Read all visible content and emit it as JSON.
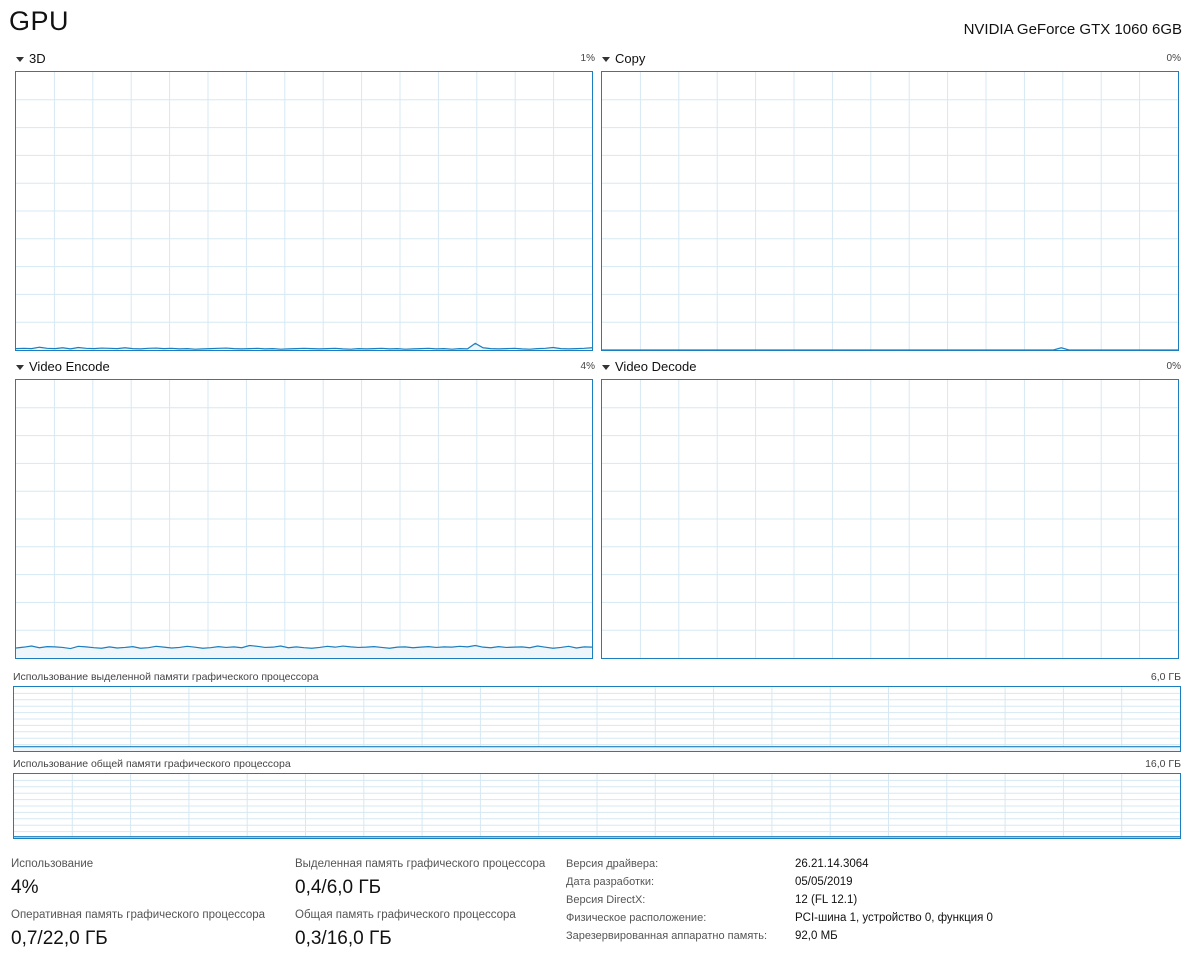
{
  "header": {
    "title": "GPU",
    "gpu_name": "NVIDIA GeForce GTX 1060 6GB"
  },
  "engines": [
    {
      "label": "3D",
      "percent": "1%",
      "samples": [
        0.5,
        0.6,
        0.5,
        1,
        0.6,
        0.5,
        0.8,
        0.4,
        0.9,
        0.6,
        0.5,
        0.7,
        0.6,
        0.5,
        0.8,
        0.5,
        0.4,
        0.6,
        0.7,
        0.5,
        0.6,
        0.4,
        0.5,
        0.3,
        0.4,
        0.5,
        0.6,
        0.7,
        0.5,
        0.4,
        0.5,
        0.6,
        0.4,
        0.5,
        0.3,
        0.4,
        0.5,
        0.6,
        0.5,
        0.4,
        0.5,
        0.6,
        0.4,
        0.3,
        0.5,
        0.4,
        0.5,
        0.6,
        0.4,
        0.5,
        0.3,
        0.4,
        0.5,
        0.6,
        0.4,
        0.5,
        0.3,
        0.5,
        0.4,
        2.4,
        0.8,
        0.5,
        0.4,
        0.5,
        0.6,
        0.4,
        0.3,
        0.5,
        0.6,
        0.9,
        0.5,
        0.4,
        0.5,
        0.6,
        0.8
      ]
    },
    {
      "label": "Copy",
      "percent": "0%",
      "samples": [
        0,
        0,
        0,
        0,
        0,
        0,
        0,
        0,
        0,
        0,
        0,
        0,
        0,
        0,
        0,
        0,
        0,
        0,
        0,
        0,
        0,
        0,
        0,
        0,
        0,
        0,
        0,
        0,
        0,
        0,
        0,
        0,
        0,
        0,
        0,
        0,
        0,
        0,
        0,
        0,
        0,
        0,
        0,
        0,
        0,
        0,
        0,
        0,
        0,
        0,
        0,
        0,
        0,
        0,
        0,
        0,
        0,
        0,
        0,
        0.8,
        0,
        0,
        0,
        0,
        0,
        0,
        0,
        0,
        0,
        0,
        0,
        0,
        0,
        0,
        0
      ]
    },
    {
      "label": "Video Encode",
      "percent": "4%",
      "samples": [
        3.6,
        3.9,
        4.3,
        3.7,
        4.1,
        4,
        3.8,
        3.4,
        4.2,
        4,
        3.7,
        3.5,
        4,
        3.6,
        3.8,
        4.1,
        3.5,
        3.7,
        4.2,
        3.9,
        3.6,
        3.8,
        4.2,
        3.9,
        3.5,
        3.7,
        4.1,
        3.8,
        4,
        3.7,
        4.5,
        4.2,
        3.8,
        3.9,
        4.3,
        3.7,
        4,
        3.7,
        3.5,
        3.8,
        4.2,
        3.9,
        4.3,
        4,
        3.8,
        3.9,
        4.1,
        3.8,
        3.5,
        3.9,
        4,
        3.7,
        3.9,
        4.1,
        3.8,
        4,
        3.9,
        4.2,
        4,
        4.5,
        3.9,
        3.7,
        4.1,
        3.8,
        3.9,
        4,
        3.7,
        4.3,
        3.9,
        3.5,
        3.8,
        4.2,
        3.6,
        4,
        3.9
      ]
    },
    {
      "label": "Video Decode",
      "percent": "0%",
      "samples": []
    }
  ],
  "memory": [
    {
      "label": "Использование выделенной памяти графического процессора",
      "max": "6,0 ГБ",
      "fraction": 0.067
    },
    {
      "label": "Использование общей памяти графического процессора",
      "max": "16,0 ГБ",
      "fraction": 0.019
    }
  ],
  "stats": {
    "utilization_label": "Использование",
    "utilization_value": "4%",
    "dedicated_label": "Выделенная память графического процессора",
    "dedicated_value": "0,4/6,0 ГБ",
    "gpu_memory_label": "Оперативная память графического процессора",
    "gpu_memory_value": "0,7/22,0 ГБ",
    "shared_label": "Общая память графического процессора",
    "shared_value": "0,3/16,0 ГБ"
  },
  "info": [
    {
      "label": "Версия драйвера:",
      "value": "26.21.14.3064"
    },
    {
      "label": "Дата разработки:",
      "value": "05/05/2019"
    },
    {
      "label": "Версия DirectX:",
      "value": "12 (FL 12.1)"
    },
    {
      "label": "Физическое расположение:",
      "value": "PCI-шина 1, устройство 0, функция 0"
    },
    {
      "label": "Зарезервированная аппаратно память:",
      "value": "92,0 МБ"
    }
  ],
  "colors": {
    "accent": "#1b7fbf",
    "grid": "#d5e8f3",
    "fill": "#eef6fb"
  }
}
